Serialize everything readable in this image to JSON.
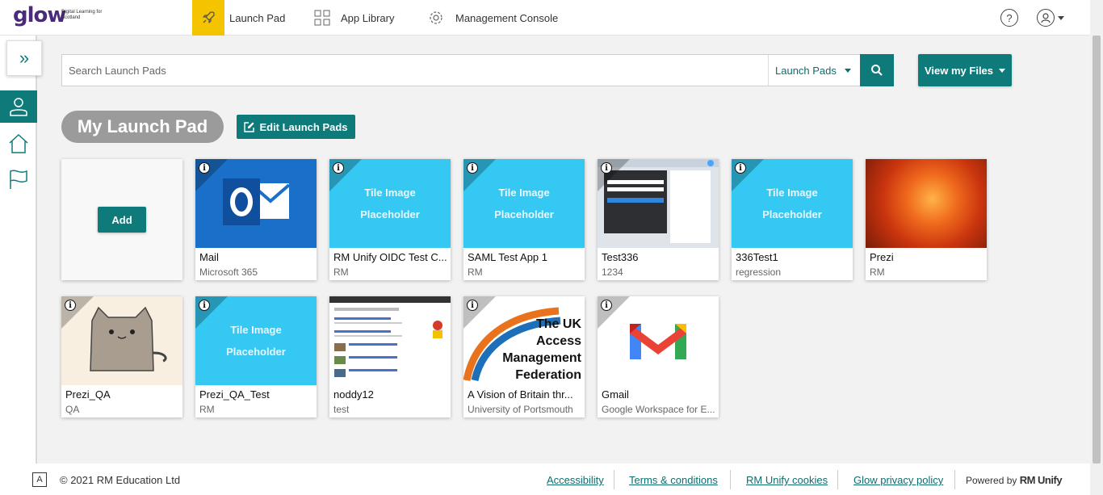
{
  "logo": {
    "brand": "glow",
    "tagline": "Digital Learning for Scotland"
  },
  "nav": [
    {
      "label": "Launch Pad",
      "icon": "rocket-icon",
      "active": true
    },
    {
      "label": "App Library",
      "icon": "grid-icon",
      "active": false
    },
    {
      "label": "Management Console",
      "icon": "gear-icon",
      "active": false
    }
  ],
  "header_right": {
    "help_icon": "help-icon",
    "user_icon": "user-icon"
  },
  "search": {
    "placeholder": "Search Launch Pads",
    "scope": "Launch Pads"
  },
  "files_button": "View my Files",
  "pad_title": "My Launch Pad",
  "edit_button": "Edit Launch Pads",
  "add_button": "Add",
  "tiles": [
    {
      "name": "Mail",
      "sub": "Microsoft 365",
      "image": "outlook"
    },
    {
      "name": "RM Unify OIDC Test C...",
      "sub": "RM",
      "image": "placeholder"
    },
    {
      "name": "SAML Test App 1",
      "sub": "RM",
      "image": "placeholder"
    },
    {
      "name": "Test336",
      "sub": "1234",
      "image": "screenshot"
    },
    {
      "name": "336Test1",
      "sub": "regression",
      "image": "placeholder"
    },
    {
      "name": "Prezi",
      "sub": "RM",
      "image": "flower"
    },
    {
      "name": "Prezi_QA",
      "sub": "QA",
      "image": "cat"
    },
    {
      "name": "Prezi_QA_Test",
      "sub": "RM",
      "image": "placeholder"
    },
    {
      "name": "noddy12",
      "sub": "test",
      "image": "search-results"
    },
    {
      "name": "A Vision of Britain thr...",
      "sub": "University of Portsmouth",
      "image": "ukamf"
    },
    {
      "name": "Gmail",
      "sub": "Google Workspace for E...",
      "image": "gmail"
    }
  ],
  "placeholder_text": [
    "Tile Image",
    "Placeholder"
  ],
  "ukamf_text": [
    "The UK",
    "Access",
    "Management",
    "Federation"
  ],
  "info_glyph": "i",
  "footer": {
    "a_icon": "A",
    "copyright": "© 2021 RM Education Ltd",
    "links": [
      "Accessibility",
      "Terms & conditions",
      "RM Unify cookies",
      "Glow privacy policy"
    ],
    "powered_prefix": "Powered by",
    "powered_brand": "RM Unify"
  },
  "colors": {
    "teal": "#0e7a7a",
    "active_nav": "#f5c400",
    "placeholder_blue": "#35c8f2"
  }
}
